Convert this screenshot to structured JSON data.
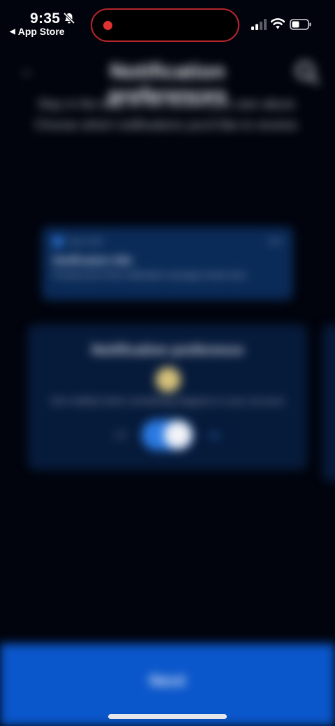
{
  "status_bar": {
    "time": "9:35",
    "back_label": "App Store"
  },
  "app": {
    "title": "Notification preferences",
    "subtitle_line1": "Stay in the loop on the content you care about.",
    "subtitle_line2": "Choose which notifications you'd like to receive.",
    "preview": {
      "app_name": "App name",
      "time": "now",
      "title": "Notification title",
      "body": "Preview text of the notification message shown here."
    },
    "setting": {
      "title": "Notification preference",
      "description": "Get notified when something happens in your account.",
      "off_label": "Off",
      "on_label": "On",
      "enabled": true
    },
    "primary_button_label": "Next"
  },
  "colors": {
    "background": "#01040d",
    "accent": "#0a56cb",
    "recording": "#e0332f"
  }
}
